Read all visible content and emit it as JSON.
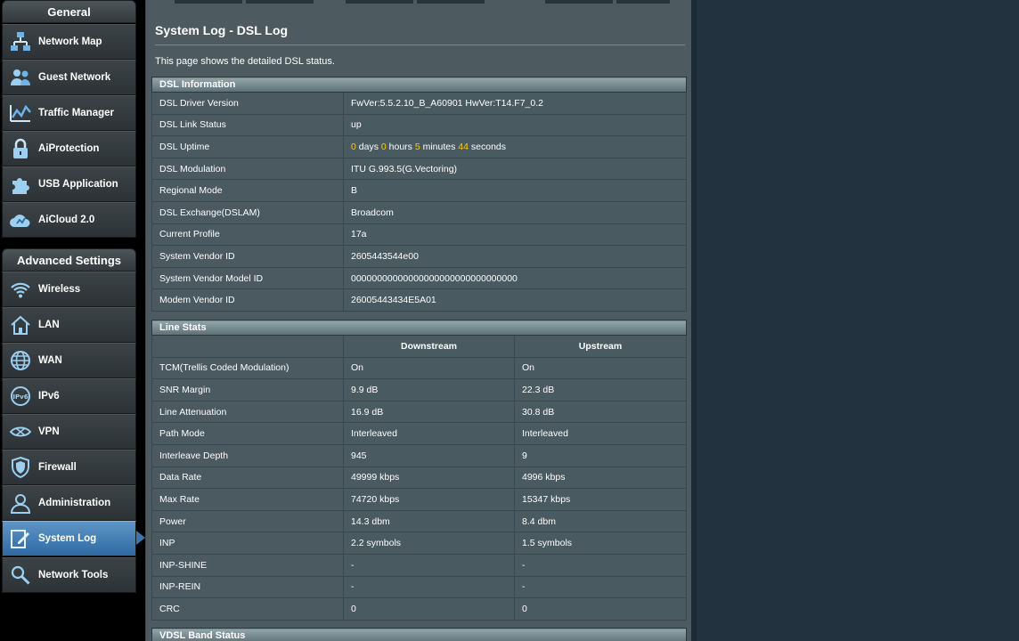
{
  "sidebar": {
    "general_header": "General",
    "general_items": [
      {
        "label": "Network Map",
        "icon": "network-map-icon"
      },
      {
        "label": "Guest Network",
        "icon": "guest-network-icon"
      },
      {
        "label": "Traffic Manager",
        "icon": "traffic-manager-icon"
      },
      {
        "label": "AiProtection",
        "icon": "lock-icon"
      },
      {
        "label": "USB Application",
        "icon": "puzzle-icon"
      },
      {
        "label": "AiCloud 2.0",
        "icon": "cloud-icon"
      }
    ],
    "advanced_header": "Advanced Settings",
    "advanced_items": [
      {
        "label": "Wireless",
        "icon": "wifi-icon"
      },
      {
        "label": "LAN",
        "icon": "home-icon"
      },
      {
        "label": "WAN",
        "icon": "globe-icon"
      },
      {
        "label": "IPv6",
        "icon": "ipv6-icon"
      },
      {
        "label": "VPN",
        "icon": "vpn-icon"
      },
      {
        "label": "Firewall",
        "icon": "shield-icon"
      },
      {
        "label": "Administration",
        "icon": "admin-user-icon"
      },
      {
        "label": "System Log",
        "icon": "system-log-icon",
        "active": true
      },
      {
        "label": "Network Tools",
        "icon": "network-tools-icon"
      }
    ]
  },
  "main": {
    "title": "System Log - DSL Log",
    "description": "This page shows the detailed DSL status.",
    "dsl_info": {
      "header": "DSL Information",
      "rows": [
        {
          "key": "DSL Driver Version",
          "value": "FwVer:5.5.2.10_B_A60901 HwVer:T14.F7_0.2"
        },
        {
          "key": "DSL Link Status",
          "value": "up"
        },
        {
          "key": "DSL Uptime",
          "days": "0",
          "days_label": "days",
          "hours": "0",
          "hours_label": "hours",
          "minutes": "5",
          "minutes_label": "minutes",
          "seconds": "44",
          "seconds_label": "seconds"
        },
        {
          "key": "DSL Modulation",
          "value": "ITU G.993.5(G.Vectoring)"
        },
        {
          "key": "Regional Mode",
          "value": "B"
        },
        {
          "key": "DSL Exchange(DSLAM)",
          "value": "Broadcom"
        },
        {
          "key": "Current Profile",
          "value": "17a"
        },
        {
          "key": "System Vendor ID",
          "value": "2605443544e00"
        },
        {
          "key": "System Vendor Model ID",
          "value": "00000000000000000000000000000000"
        },
        {
          "key": "Modem Vendor ID",
          "value": "26005443434E5A01"
        }
      ]
    },
    "line_stats": {
      "header": "Line Stats",
      "col_downstream": "Downstream",
      "col_upstream": "Upstream",
      "rows": [
        {
          "key": "TCM(Trellis Coded Modulation)",
          "down": "On",
          "up": "On"
        },
        {
          "key": "SNR Margin",
          "down": "9.9 dB",
          "up": "22.3 dB"
        },
        {
          "key": "Line Attenuation",
          "down": "16.9 dB",
          "up": "30.8 dB"
        },
        {
          "key": "Path Mode",
          "down": "Interleaved",
          "up": "Interleaved"
        },
        {
          "key": "Interleave Depth",
          "down": "945",
          "up": "9"
        },
        {
          "key": "Data Rate",
          "down": "49999 kbps",
          "up": "4996 kbps"
        },
        {
          "key": "Max Rate",
          "down": "74720 kbps",
          "up": "15347 kbps"
        },
        {
          "key": "Power",
          "down": "14.3 dbm",
          "up": "8.4 dbm"
        },
        {
          "key": "INP",
          "down": "2.2 symbols",
          "up": "1.5 symbols"
        },
        {
          "key": "INP-SHINE",
          "down": "-",
          "up": "-"
        },
        {
          "key": "INP-REIN",
          "down": "-",
          "up": "-"
        },
        {
          "key": "CRC",
          "down": "0",
          "up": "0"
        }
      ]
    },
    "vdsl_band": {
      "header": "VDSL Band Status"
    }
  },
  "colors": {
    "highlight_number": "#ffcc00",
    "active_nav": "#3b77ae"
  }
}
